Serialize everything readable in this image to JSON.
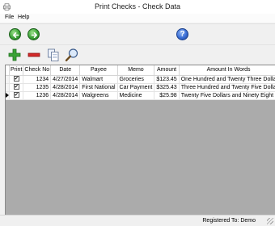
{
  "window": {
    "title": "Print Checks - Check Data"
  },
  "menu": {
    "items": [
      "File",
      "Help"
    ]
  },
  "nav": {
    "help_symbol": "?"
  },
  "grid": {
    "columns": [
      "Print",
      "Check No",
      "Date",
      "Payee",
      "Memo",
      "Amount",
      "Amount In Words"
    ],
    "rows": [
      {
        "print": true,
        "check_no": "1234",
        "date": "4/27/2014",
        "payee": "Walmart",
        "memo": "Groceries",
        "amount": "$123.45",
        "words": "One Hundred and Twenty Three Dolla"
      },
      {
        "print": true,
        "check_no": "1235",
        "date": "4/28/2014",
        "payee": "First National",
        "memo": "Car Payment",
        "amount": "$325.43",
        "words": "Three Hundred and Twenty Five Dolla"
      },
      {
        "print": true,
        "check_no": "1236",
        "date": "4/28/2014",
        "payee": "Walgreens",
        "memo": "Medicine",
        "amount": "$25.98",
        "words": "Twenty Five Dollars and Ninety Eight"
      }
    ],
    "current_row": 2
  },
  "status": {
    "text": "Registered To: Demo"
  },
  "icons": {
    "back": "arrow-left-icon",
    "forward": "arrow-right-icon",
    "help": "help-icon",
    "add": "plus-icon",
    "remove": "minus-icon",
    "copy": "copy-icon",
    "search": "magnifier-icon"
  },
  "colors": {
    "accent_green": "#3aa236",
    "remove_red": "#d42a2a",
    "help_blue": "#3a6ed6"
  }
}
